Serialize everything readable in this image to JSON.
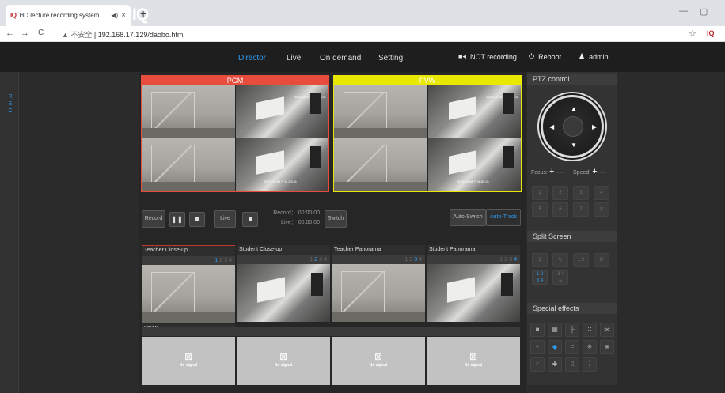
{
  "browser": {
    "tab_title": "HD lecture recording system",
    "tab_close": "×",
    "new_tab": "+",
    "back": "←",
    "forward": "→",
    "reload": "C",
    "security": "▲ 不安全",
    "url": "192.168.17.129/daobo.html",
    "star": "☆",
    "logo": "IQ"
  },
  "header": {
    "logo": "IQ",
    "nav": [
      "Director",
      "Live",
      "On demand",
      "Setting"
    ],
    "active_nav": "Director",
    "recording_status": "NOT recording",
    "reboot": "Reboot",
    "user": "admin"
  },
  "sidebar": {
    "rec_label": [
      "R",
      "E",
      "C"
    ]
  },
  "pgm": {
    "label": "PGM",
    "color": "#e74c3c"
  },
  "pvw": {
    "label": "PVW",
    "color": "#e8e800"
  },
  "camera_timestamp": "2020-12-08 ** 11:53:31 ",
  "controls": {
    "record": "Record",
    "live": "Live",
    "record_time": "Record： 00:00:00",
    "live_time": "Live： 00:00:00",
    "switch": "Switch",
    "auto_switch": "Auto-Switch",
    "auto_track": "Auto-Track"
  },
  "channels": [
    {
      "name": "Teacher Close-up",
      "nums": [
        "1",
        "2",
        "3",
        "4"
      ],
      "active": "1"
    },
    {
      "name": "Student Close-up",
      "nums": [
        "1",
        "2",
        "3",
        "4"
      ],
      "active": "2"
    },
    {
      "name": "Teacher Panorama",
      "nums": [
        "1",
        "2",
        "3",
        "4"
      ],
      "active": "3"
    },
    {
      "name": "Student Panorama",
      "nums": [
        "1",
        "2",
        "3",
        "4"
      ],
      "active": "4"
    }
  ],
  "hdmi": {
    "label": "HDMI",
    "no_signal": "No signal"
  },
  "ptz": {
    "title": "PTZ control",
    "focus": "Focus:",
    "speed": "Speed:",
    "plus": "+",
    "minus": "—",
    "presets": [
      "1",
      "2",
      "3",
      "4",
      "5",
      "6",
      "7",
      "8"
    ]
  },
  "split_screen": {
    "title": "Split Screen"
  },
  "special_effects": {
    "title": "Special effects"
  },
  "colors": {
    "accent": "#2f9bf0",
    "pgm": "#e74c3c",
    "pvw": "#e8e800",
    "bg": "#2b2b2b"
  }
}
